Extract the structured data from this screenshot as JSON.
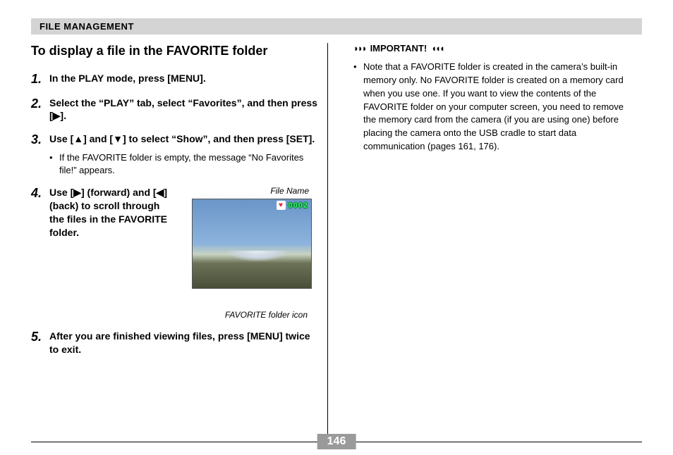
{
  "header": "FILE MANAGEMENT",
  "title": "To display a file in the FAVORITE folder",
  "steps": {
    "s1": {
      "num": "1.",
      "text": "In the PLAY mode, press [MENU]."
    },
    "s2": {
      "num": "2.",
      "text": "Select the “PLAY” tab, select “Favorites”, and then press [▶]."
    },
    "s3": {
      "num": "3.",
      "text": "Use [▲] and [▼] to select “Show”, and then press [SET].",
      "sub": "If the FAVORITE folder is empty, the message “No Favorites file!” appears."
    },
    "s4": {
      "num": "4.",
      "text": "Use [▶] (forward) and [◀] (back) to scroll through the files in the FAVORITE folder."
    },
    "s5": {
      "num": "5.",
      "text": "After you are finished viewing files, press [MENU] twice to exit."
    }
  },
  "figure": {
    "label_top": "File Name",
    "file_number": "0002",
    "label_bottom": "FAVORITE folder icon"
  },
  "important": {
    "label": "IMPORTANT!",
    "note": "Note that a FAVORITE folder is created in the camera’s built-in memory only. No FAVORITE folder is created on a memory card when you use one. If you want to view the contents of the FAVORITE folder on your computer screen, you need to remove the memory card from the camera (if you are using one) before placing the camera onto the USB cradle to start data communication (pages 161, 176)."
  },
  "page_number": "146"
}
